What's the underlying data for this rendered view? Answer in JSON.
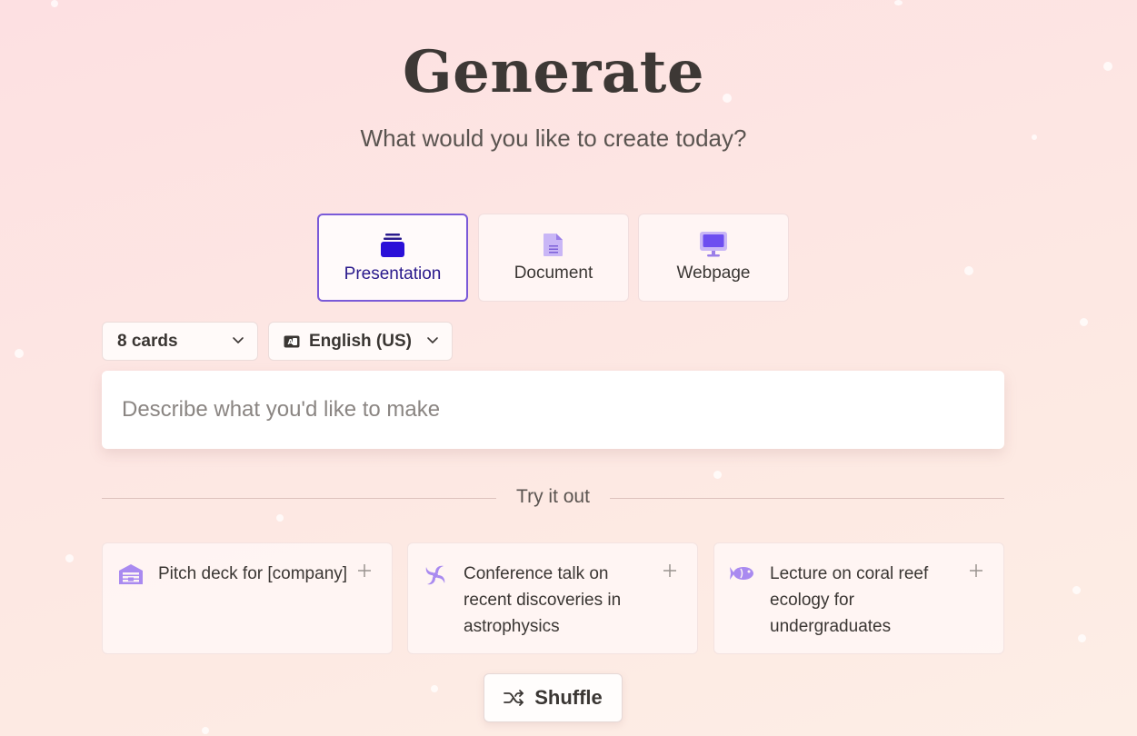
{
  "header": {
    "title": "Generate",
    "subtitle": "What would you like to create today?"
  },
  "type_options": [
    {
      "label": "Presentation",
      "icon": "stack-icon",
      "selected": true
    },
    {
      "label": "Document",
      "icon": "document-icon",
      "selected": false
    },
    {
      "label": "Webpage",
      "icon": "monitor-icon",
      "selected": false
    }
  ],
  "settings": {
    "cards": {
      "value": "8 cards",
      "icon": "chevron-down-icon"
    },
    "language": {
      "value": "English (US)",
      "icon": "translate-icon"
    }
  },
  "prompt": {
    "placeholder": "Describe what you'd like to make",
    "value": ""
  },
  "try_it_out": {
    "label": "Try it out",
    "examples": [
      {
        "text": "Pitch deck for [company]",
        "icon": "building-icon"
      },
      {
        "text": "Conference talk on recent discoveries in astrophysics",
        "icon": "galaxy-icon"
      },
      {
        "text": "Lecture on coral reef ecology for undergraduates",
        "icon": "fish-icon"
      }
    ]
  },
  "shuffle": {
    "label": "Shuffle",
    "icon": "shuffle-icon"
  },
  "colors": {
    "accent": "#7a5ad8",
    "selected_text": "#2a1a8c",
    "icon_purple": "#b08ef0",
    "background": "#fde4e3"
  }
}
